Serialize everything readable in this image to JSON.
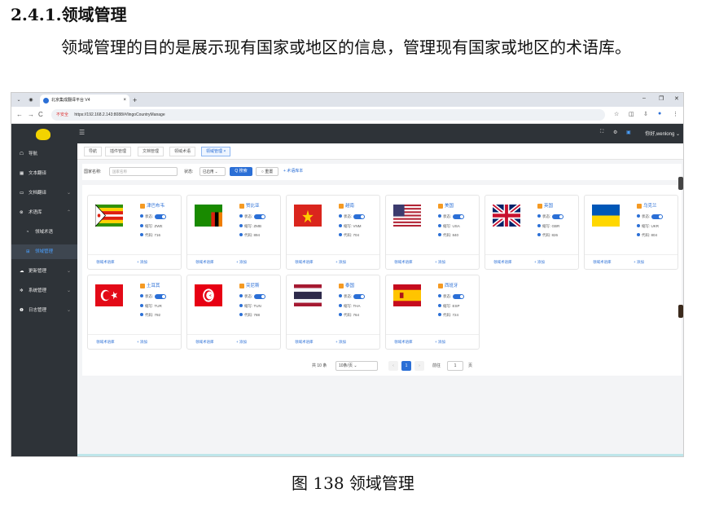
{
  "doc": {
    "heading": "2.4.1.领域管理",
    "paragraph": "领域管理的目的是展示现有国家或地区的信息，管理现有国家或地区的术语库。",
    "caption": "图 138 领域管理"
  },
  "browser": {
    "tab_title": "北京集成翻译平台 V4",
    "new_tab": "+",
    "tab_close": "×",
    "window_controls": [
      "–",
      "❐",
      "✕"
    ],
    "nav": [
      "←",
      "→",
      "C"
    ],
    "security": "不安全",
    "url": "https://192.168.2.143:8088/#/lingoCountryManage",
    "right_icons": [
      "☆",
      "◫",
      "⇩",
      "●",
      "⋮"
    ]
  },
  "sidebar": {
    "items": [
      {
        "icon": "nav-icon",
        "glyph": "☖",
        "label": "导航"
      },
      {
        "icon": "grid-icon",
        "glyph": "▦",
        "label": "文本翻译"
      },
      {
        "icon": "folder-icon",
        "glyph": "▭",
        "label": "文档翻译",
        "chev": "⌄"
      },
      {
        "icon": "termbase-icon",
        "glyph": "⊗",
        "label": "术语库",
        "chev": "⌃"
      },
      {
        "icon": "term-icon",
        "glyph": "◔",
        "label": "领域术语"
      },
      {
        "icon": "domain-icon",
        "glyph": "⊞",
        "label": "领域管理"
      },
      {
        "icon": "update-icon",
        "glyph": "☁",
        "label": "更新管理",
        "chev": "⌄"
      },
      {
        "icon": "gear-icon",
        "glyph": "✲",
        "label": "系统管理",
        "chev": "⌄"
      },
      {
        "icon": "log-icon",
        "glyph": "❶",
        "label": "日志管理",
        "chev": "⌄"
      }
    ]
  },
  "topbar": {
    "menu_glyph": "☰",
    "icons": [
      "⛶",
      "⚙",
      "▣"
    ],
    "user": "你好,wenlong ⌄"
  },
  "page_tabs": [
    "导航",
    "插件管理",
    "文档管理",
    "领域术语",
    "领域管理 ×"
  ],
  "search": {
    "country_label": "国家名称:",
    "country_placeholder": "国家名称",
    "status_label": "状态:",
    "status_value": "已启用 ⌄",
    "search_btn": "Q 搜索",
    "reset_btn": "○ 重置",
    "add_btn": "+ 术语库本"
  },
  "labels": {
    "status": "状态:",
    "abbr": "缩写:",
    "code": "代码:",
    "termbase": "领域术语库",
    "add": "+ 添加"
  },
  "countries": [
    {
      "name": "津巴布韦",
      "abbr": "ZWE",
      "code": "716",
      "flag": "zimbabwe"
    },
    {
      "name": "赞比亚",
      "abbr": "ZMB",
      "code": "894",
      "flag": "zambia"
    },
    {
      "name": "越南",
      "abbr": "VNM",
      "code": "704",
      "flag": "vietnam"
    },
    {
      "name": "美国",
      "abbr": "USA",
      "code": "840",
      "flag": "usa"
    },
    {
      "name": "英国",
      "abbr": "GBR",
      "code": "826",
      "flag": "uk"
    },
    {
      "name": "乌克兰",
      "abbr": "UKR",
      "code": "804",
      "flag": "ukraine"
    },
    {
      "name": "土耳其",
      "abbr": "TUR",
      "code": "792",
      "flag": "turkey"
    },
    {
      "name": "突尼斯",
      "abbr": "TUN",
      "code": "788",
      "flag": "tunisia"
    },
    {
      "name": "泰国",
      "abbr": "THA",
      "code": "764",
      "flag": "thailand"
    },
    {
      "name": "西班牙",
      "abbr": "ESP",
      "code": "724",
      "flag": "spain"
    }
  ],
  "pager": {
    "total": "共 10 条",
    "size": "10条/页 ⌄",
    "prev": "‹",
    "page": "1",
    "next": "›",
    "goto_label": "前往",
    "goto_value": "1",
    "page_unit": "页"
  },
  "colors": {
    "accent": "#2b6fd6",
    "sidebar": "#2e3338",
    "tag": "#f59a23"
  }
}
